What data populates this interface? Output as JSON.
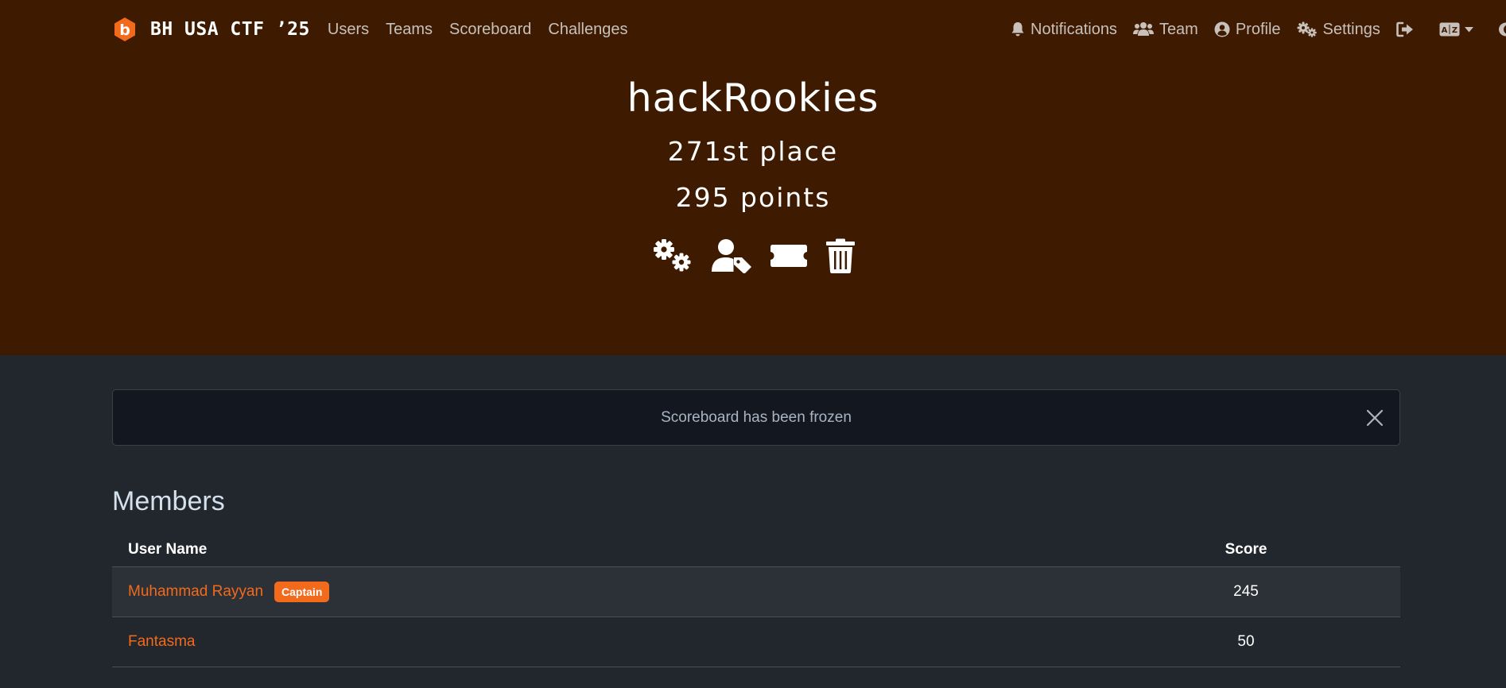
{
  "brand": {
    "title": "BH USA CTF ’25",
    "logo_letter": "b"
  },
  "nav": {
    "left": [
      {
        "label": "Users"
      },
      {
        "label": "Teams"
      },
      {
        "label": "Scoreboard"
      },
      {
        "label": "Challenges"
      }
    ],
    "right": {
      "notifications": "Notifications",
      "team": "Team",
      "profile": "Profile",
      "settings": "Settings"
    },
    "icons": [
      "bell-icon",
      "users-icon",
      "user-circle-icon",
      "gears-icon",
      "logout-icon",
      "language-icon",
      "moon-icon"
    ]
  },
  "team": {
    "name": "hackRookies",
    "place": "271st place",
    "points": "295 points",
    "action_icons": [
      "gears-icon",
      "user-tag-icon",
      "ticket-icon",
      "trash-icon"
    ]
  },
  "alert": {
    "text": "Scoreboard has been frozen"
  },
  "members": {
    "title": "Members",
    "columns": {
      "name": "User Name",
      "score": "Score"
    },
    "rows": [
      {
        "name": "Muhammad Rayyan",
        "badge": "Captain",
        "score": "245"
      },
      {
        "name": "Fantasma",
        "badge": "",
        "score": "50"
      }
    ]
  },
  "colors": {
    "hero_bg": "#3d1a00",
    "page_bg": "#22262d",
    "accent": "#f26a1b",
    "alert_bg": "#131820"
  }
}
